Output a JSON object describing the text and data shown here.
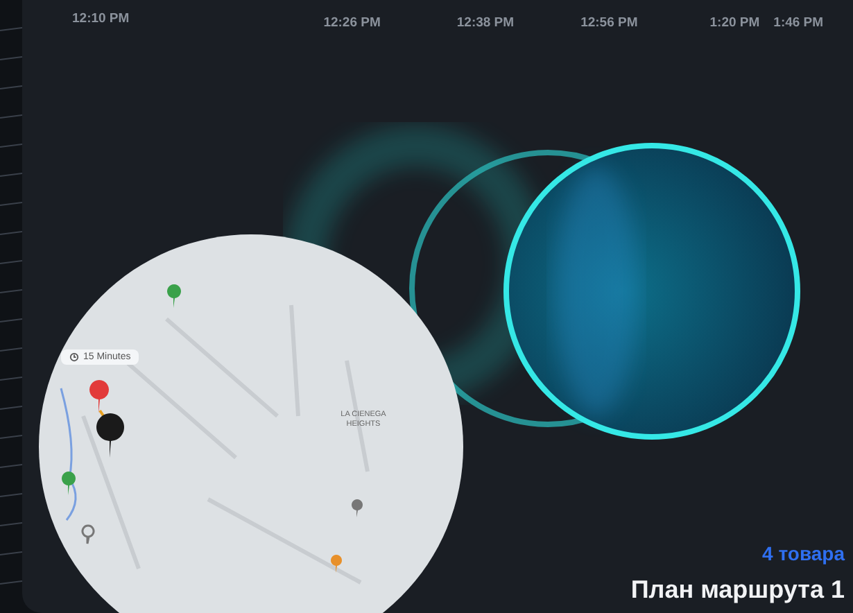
{
  "timeline": {
    "times": [
      "12:10 PM",
      "12:26 PM",
      "12:38 PM",
      "12:56 PM",
      "1:20 PM",
      "1:46 PM"
    ]
  },
  "map": {
    "duration_chip": "15 Minutes",
    "area_label": "LA CIENEGA HEIGHTS"
  },
  "route": {
    "items_count": "4 товара",
    "title": "План маршрута 1"
  }
}
